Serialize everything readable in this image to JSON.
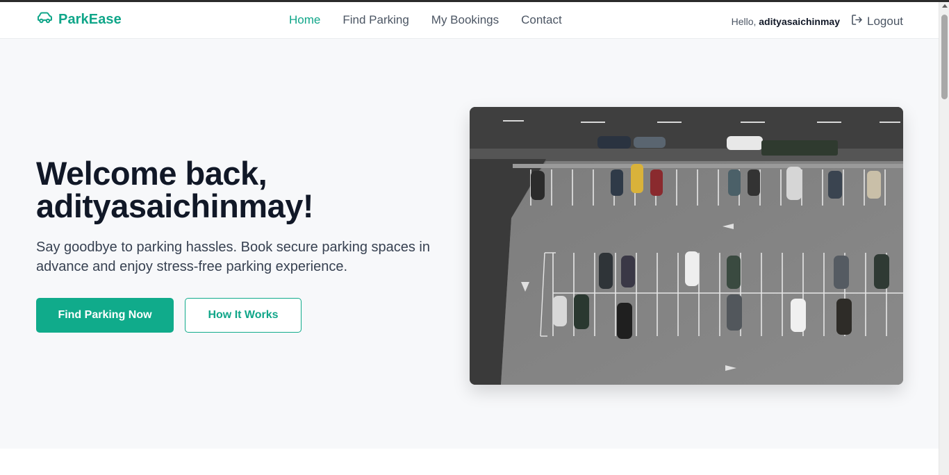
{
  "brand": {
    "name": "ParkEase",
    "icon": "car-icon",
    "color": "#10a689"
  },
  "nav": {
    "links": [
      {
        "label": "Home",
        "active": true
      },
      {
        "label": "Find Parking",
        "active": false
      },
      {
        "label": "My Bookings",
        "active": false
      },
      {
        "label": "Contact",
        "active": false
      }
    ]
  },
  "user": {
    "greeting": "Hello,",
    "username": "adityasaichinmay",
    "logout_label": "Logout",
    "logout_icon": "logout-icon"
  },
  "hero": {
    "title_line1": "Welcome back,",
    "title_line2": "adityasaichinmay!",
    "subtitle": "Say goodbye to parking hassles. Book secure parking spaces in advance and enjoy stress-free parking experience.",
    "primary_button": "Find Parking Now",
    "secondary_button": "How It Works"
  },
  "colors": {
    "accent": "#10ab8b",
    "title": "#111827",
    "background": "#f7f8fa"
  }
}
